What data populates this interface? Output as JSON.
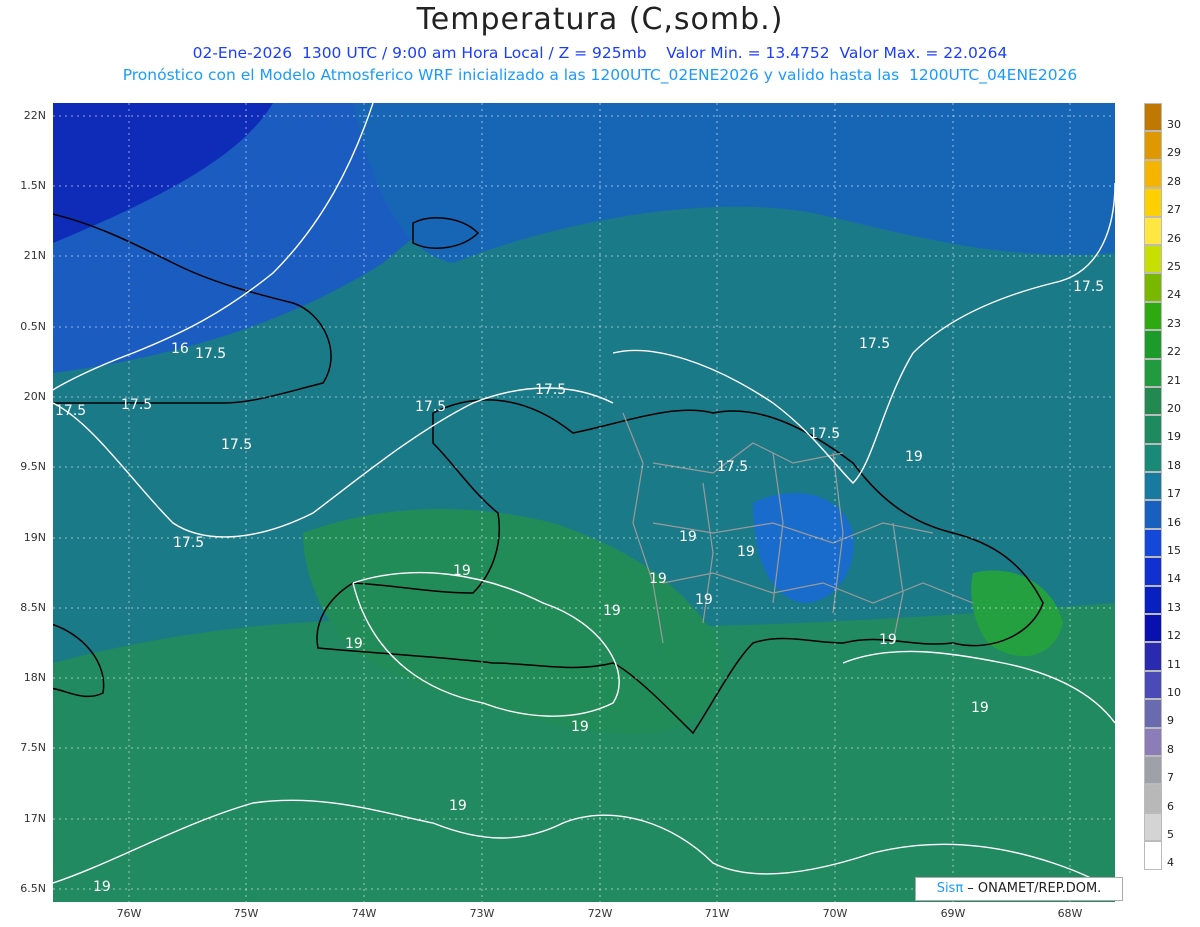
{
  "header": {
    "title": "Temperatura (C,somb.)",
    "line1": "02-Ene-2026  1300 UTC / 9:00 am Hora Local / Z = 925mb    Valor Min. = 13.4752  Valor Max. = 22.0264",
    "line2": "Pronóstico con el Modelo Atmosferico WRF inicializado a las 1200UTC_02ENE2026 y valido hasta las  1200UTC_04ENE2026"
  },
  "map": {
    "lat_labels": [
      "22N",
      "1.5N",
      "21N",
      "0.5N",
      "20N",
      "9.5N",
      "19N",
      "8.5N",
      "18N",
      "7.5N",
      "17N",
      "6.5N"
    ],
    "lon_labels": [
      "76W",
      "75W",
      "74W",
      "73W",
      "72W",
      "71W",
      "70W",
      "69W",
      "68W"
    ],
    "contour_labels": [
      "16",
      "17.5",
      "17.5",
      "17.5",
      "17.5",
      "17.5",
      "17.5",
      "17.5",
      "17.5",
      "17.5",
      "17.5",
      "17.5",
      "19",
      "19",
      "19",
      "19",
      "19",
      "19",
      "19",
      "19",
      "19",
      "19",
      "19",
      "19",
      "19"
    ]
  },
  "colorbar": {
    "labels": [
      "30",
      "29",
      "28",
      "27",
      "26",
      "25",
      "24",
      "23",
      "22",
      "21",
      "20",
      "19",
      "18",
      "17",
      "16",
      "15",
      "14",
      "13",
      "12",
      "11",
      "10",
      "9",
      "8",
      "7",
      "6",
      "5",
      "4"
    ],
    "colors": [
      "#c07800",
      "#e09800",
      "#f5b400",
      "#ffd000",
      "#ffe640",
      "#c8e000",
      "#7ab800",
      "#2caa10",
      "#1c9a2a",
      "#229a40",
      "#228a50",
      "#1e8a60",
      "#1a8a78",
      "#187aa0",
      "#1860c0",
      "#1448d8",
      "#1030d0",
      "#0820c0",
      "#0a10b0",
      "#2a2ab0",
      "#4a4ab8",
      "#6a6ab0",
      "#8c7cb8",
      "#a0a0a8",
      "#b8b8b8",
      "#d4d4d4",
      "#ffffff"
    ]
  },
  "credit": {
    "brand": "Sisπ",
    "org": " – ONAMET/REP.DOM."
  }
}
